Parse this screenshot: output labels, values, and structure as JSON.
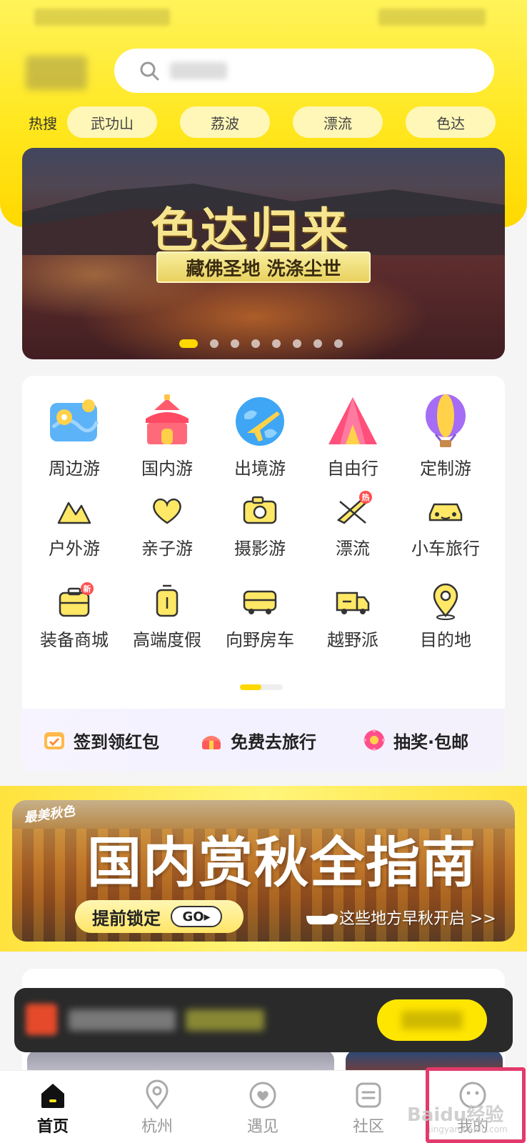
{
  "search": {
    "hot_label": "热搜",
    "hot_items": [
      "武功山",
      "荔波",
      "漂流",
      "色达"
    ]
  },
  "banner": {
    "title": "色达归来",
    "subtitle": "藏佛圣地  洗涤尘世",
    "dot_count": 8,
    "active_dot": 0
  },
  "categories": {
    "row1": [
      "周边游",
      "国内游",
      "出境游",
      "自由行",
      "定制游"
    ],
    "row2": [
      "户外游",
      "亲子游",
      "摄影游",
      "漂流",
      "小车旅行"
    ],
    "row3": [
      "装备商城",
      "高端度假",
      "向野房车",
      "越野派",
      "目的地"
    ],
    "badge_hot": "热",
    "badge_new": "新"
  },
  "promos": [
    "签到领红包",
    "免费去旅行",
    "抽奖·包邮"
  ],
  "autumn_banner": {
    "tag": "最美秋色",
    "title": "国内赏秋全指南",
    "cta": "提前锁定",
    "go": "GO▸",
    "hint": "这些地方早秋开启 >>"
  },
  "tabbar": {
    "items": [
      "首页",
      "杭州",
      "遇见",
      "社区",
      "我的"
    ],
    "active": "首页"
  },
  "watermark": {
    "main": "Baidu经验",
    "sub": "jingyan.baidu.com"
  },
  "colors": {
    "brand_yellow": "#ffe71f",
    "highlight": "#e23a6a"
  }
}
